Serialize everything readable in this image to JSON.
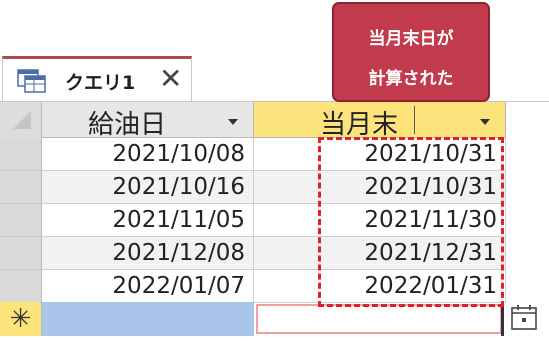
{
  "tab": {
    "title": "クエリ1",
    "close_glyph": "✕",
    "icon": "query-datasheet-icon"
  },
  "columns": [
    {
      "header": "給油日"
    },
    {
      "header": "当月末"
    }
  ],
  "rows": [
    {
      "c1": "2021/10/08",
      "c2": "2021/10/31"
    },
    {
      "c1": "2021/10/16",
      "c2": "2021/10/31"
    },
    {
      "c1": "2021/11/05",
      "c2": "2021/11/30"
    },
    {
      "c1": "2021/12/08",
      "c2": "2021/12/31"
    },
    {
      "c1": "2022/01/07",
      "c2": "2022/01/31"
    }
  ],
  "new_row_marker": "✳",
  "callout": {
    "line1": "当月末日が",
    "line2": "計算された"
  },
  "colors": {
    "callout_bg": "#c23b4c",
    "highlight_dash": "#e0202a",
    "active_header": "#fce37b",
    "new_row_cell": "#a9c6ea"
  }
}
